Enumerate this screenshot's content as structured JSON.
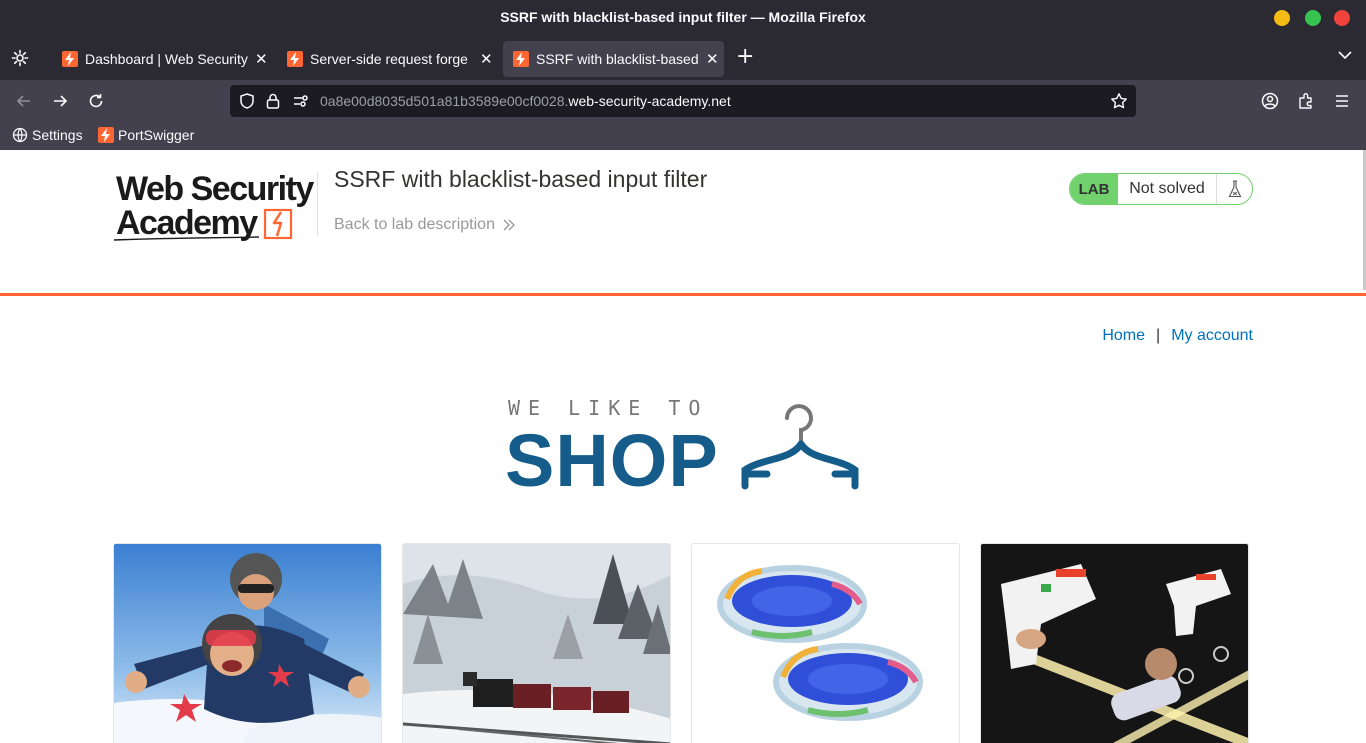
{
  "window": {
    "title": "SSRF with blacklist-based input filter — Mozilla Firefox"
  },
  "tabs": [
    {
      "label": "Dashboard | Web Security"
    },
    {
      "label": "Server-side request forge"
    },
    {
      "label": "SSRF with blacklist-based"
    }
  ],
  "url": {
    "prefix": "0a8e00d8035d501a81b3589e00cf0028.",
    "domain": "web-security-academy.net"
  },
  "bookmarks": [
    {
      "label": "Settings",
      "icon": "globe-icon"
    },
    {
      "label": "PortSwigger",
      "icon": "portswigger-icon"
    }
  ],
  "header": {
    "logo_line1": "Web Security",
    "logo_line2": "Academy",
    "lab_title": "SSRF with blacklist-based input filter",
    "back_link": "Back to lab description",
    "badge_tag": "LAB",
    "badge_status": "Not solved"
  },
  "nav": {
    "home": "Home",
    "separator": "|",
    "account": "My account"
  },
  "banner": {
    "sub": "WE LIKE TO",
    "main": "SHOP"
  },
  "colors": {
    "accent": "#ff6633",
    "link": "#0071bc",
    "shop": "#155c8a",
    "lab_green": "#70d16d"
  },
  "products": [
    {
      "name": "skydiving-product-image"
    },
    {
      "name": "snowy-train-product-image"
    },
    {
      "name": "paddling-pools-product-image"
    },
    {
      "name": "laser-tag-product-image"
    }
  ]
}
